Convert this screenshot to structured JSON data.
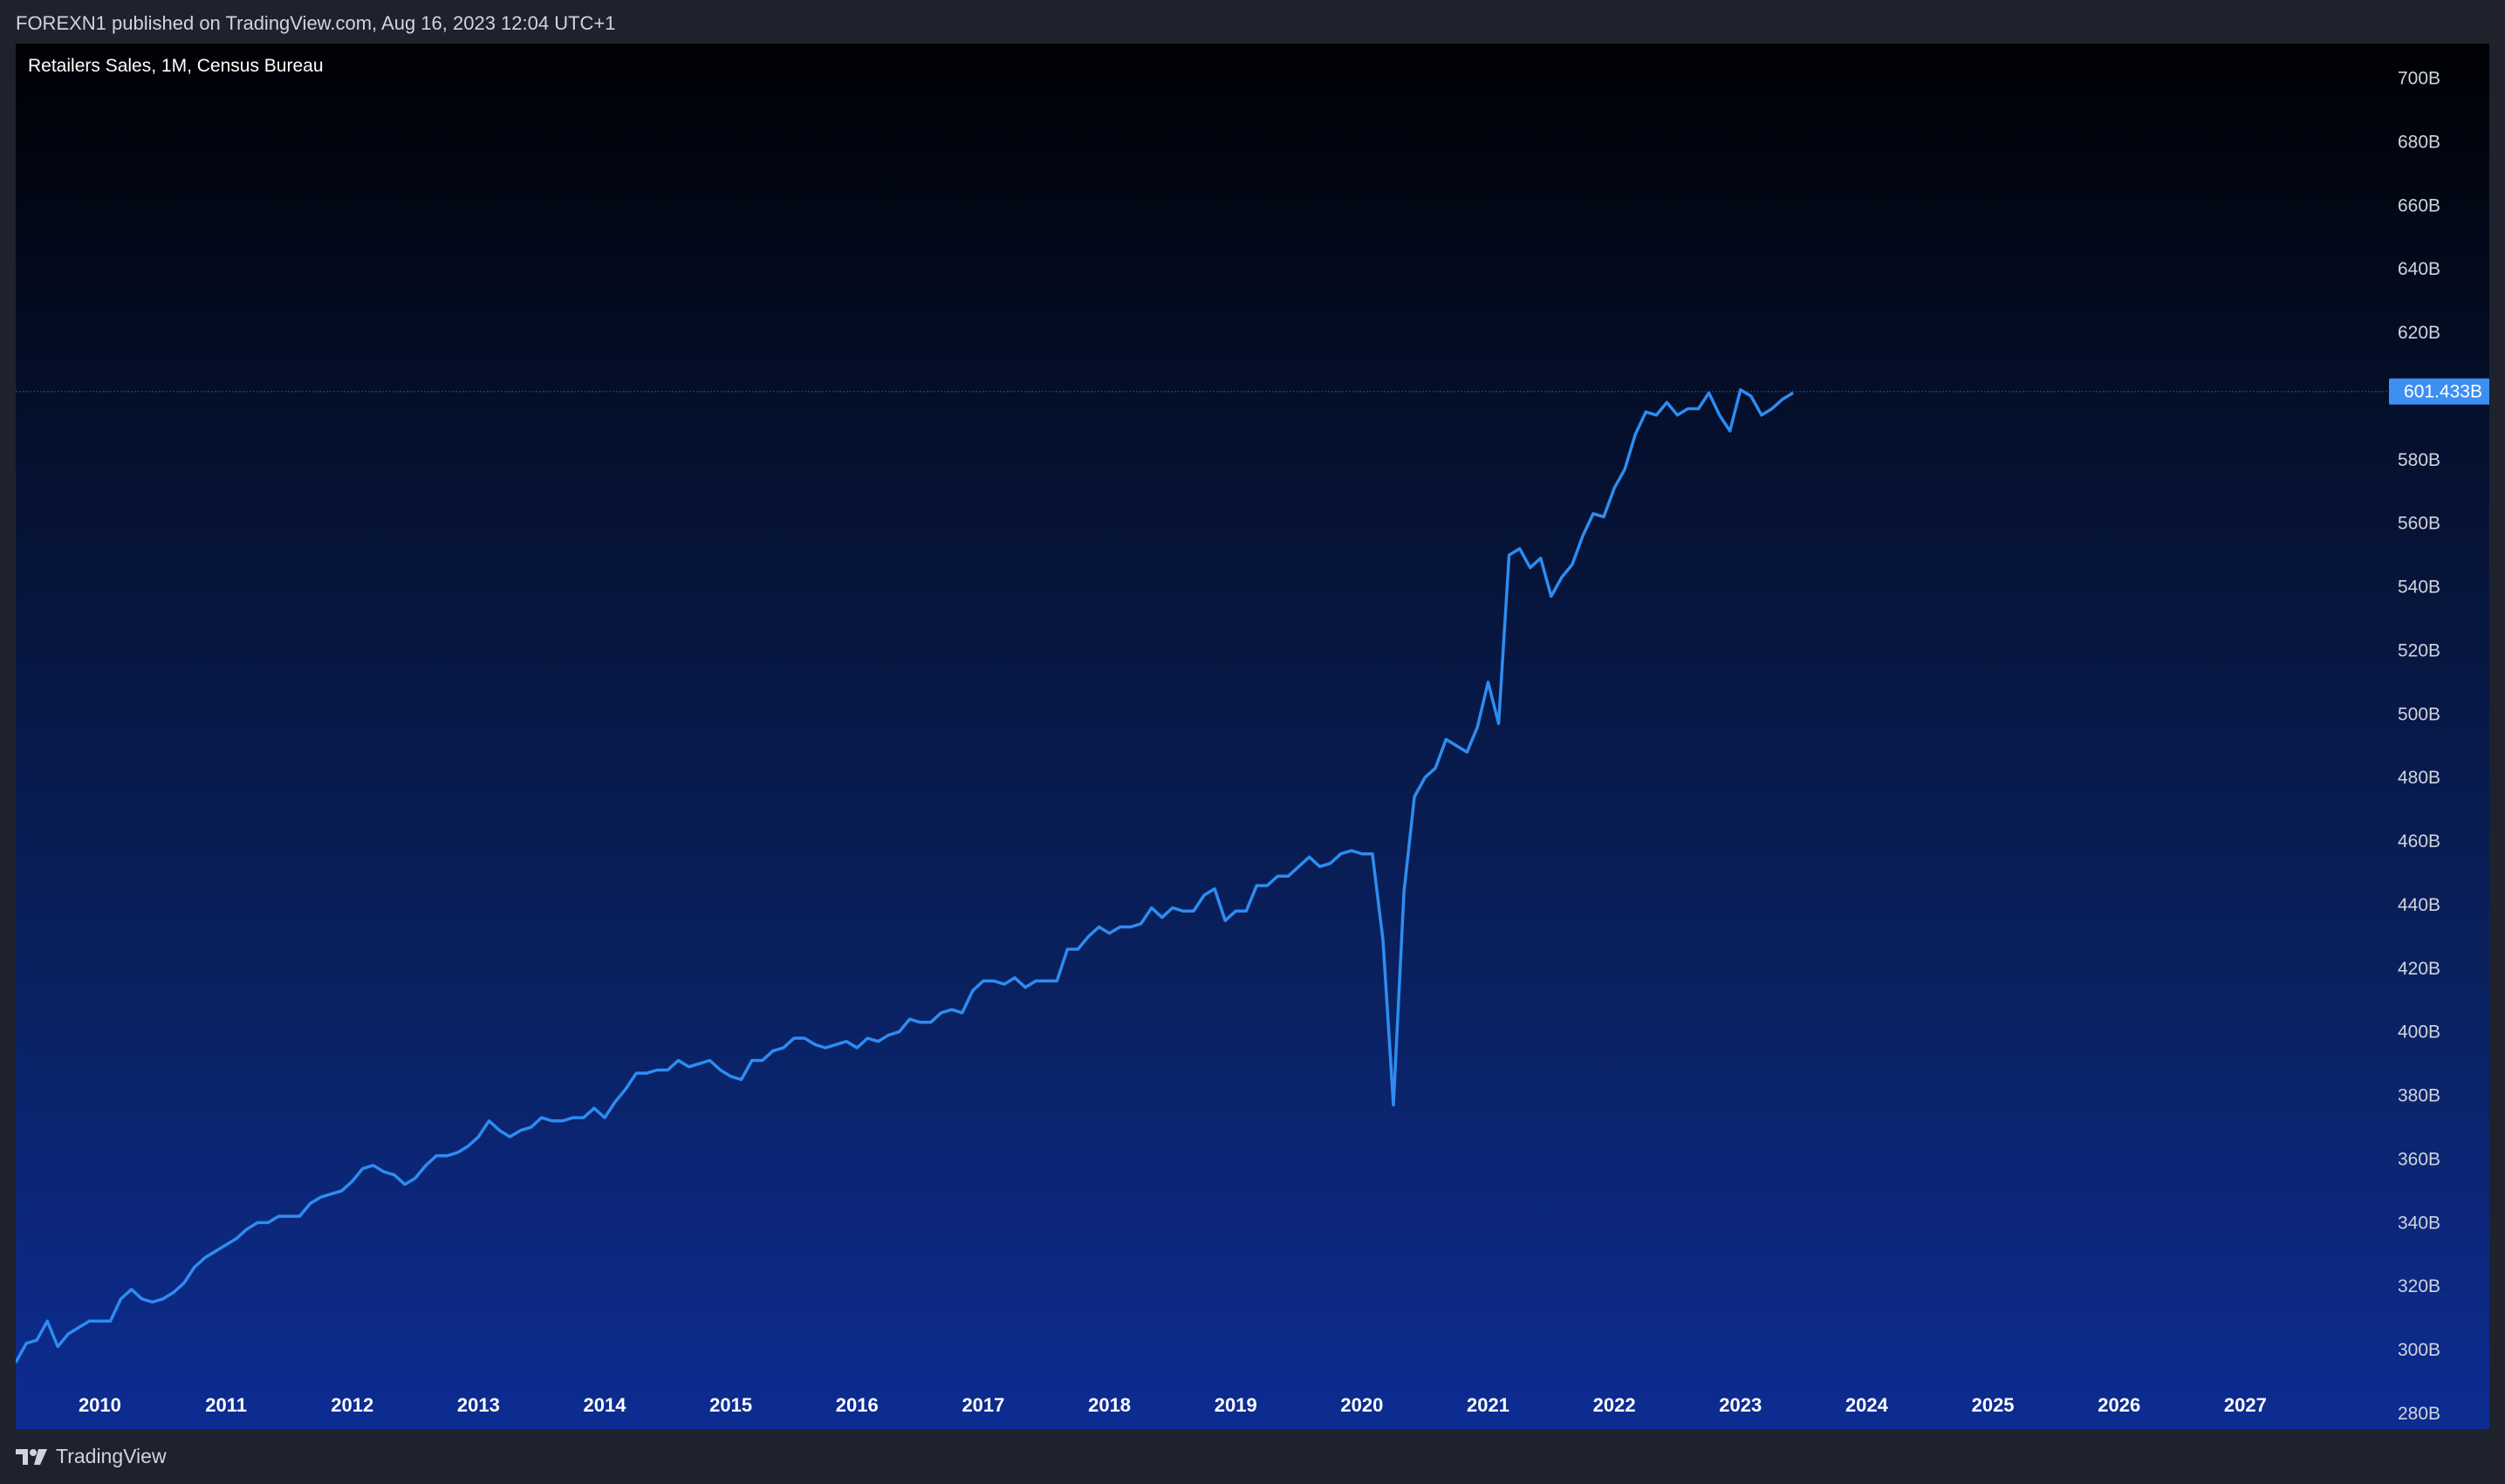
{
  "header": {
    "published": "FOREXN1 published on TradingView.com, Aug 16, 2023 12:04 UTC+1"
  },
  "footer": {
    "brand": "TradingView"
  },
  "colors": {
    "line": "#2e8cf0",
    "price_tag_bg": "#3d8ff2",
    "price_tag_text": "#ffffff"
  },
  "chart_data": {
    "type": "line",
    "title": "Retailers Sales, 1M, Census Bureau",
    "xlabel": "",
    "ylabel": "",
    "x_range": [
      "2009-05",
      "2028-01"
    ],
    "ylim": [
      280,
      704
    ],
    "y_unit": "B",
    "y_ticks": [
      280,
      300,
      320,
      340,
      360,
      380,
      400,
      420,
      440,
      460,
      480,
      500,
      520,
      540,
      560,
      580,
      620,
      640,
      660,
      680,
      700
    ],
    "y_tick_labels": [
      "280B",
      "300B",
      "320B",
      "340B",
      "360B",
      "380B",
      "400B",
      "420B",
      "440B",
      "460B",
      "480B",
      "500B",
      "520B",
      "540B",
      "560B",
      "580B",
      "620B",
      "640B",
      "660B",
      "680B",
      "700B"
    ],
    "x_tick_labels": [
      "2010",
      "2011",
      "2012",
      "2013",
      "2014",
      "2015",
      "2016",
      "2017",
      "2018",
      "2019",
      "2020",
      "2021",
      "2022",
      "2023",
      "2024",
      "2025",
      "2026",
      "2027"
    ],
    "last_value": 601.433,
    "last_value_label": "601.433B",
    "grid": false,
    "series": [
      {
        "x": [
          "2009-05",
          "2009-06",
          "2009-07",
          "2009-08",
          "2009-09",
          "2009-10",
          "2009-11",
          "2009-12",
          "2010-01",
          "2010-02",
          "2010-03",
          "2010-04",
          "2010-05",
          "2010-06",
          "2010-07",
          "2010-08",
          "2010-09",
          "2010-10",
          "2010-11",
          "2010-12",
          "2011-01",
          "2011-02",
          "2011-03",
          "2011-04",
          "2011-05",
          "2011-06",
          "2011-07",
          "2011-08",
          "2011-09",
          "2011-10",
          "2011-11",
          "2011-12",
          "2012-01",
          "2012-02",
          "2012-03",
          "2012-04",
          "2012-05",
          "2012-06",
          "2012-07",
          "2012-08",
          "2012-09",
          "2012-10",
          "2012-11",
          "2012-12",
          "2013-01",
          "2013-02",
          "2013-03",
          "2013-04",
          "2013-05",
          "2013-06",
          "2013-07",
          "2013-08",
          "2013-09",
          "2013-10",
          "2013-11",
          "2013-12",
          "2014-01",
          "2014-02",
          "2014-03",
          "2014-04",
          "2014-05",
          "2014-06",
          "2014-07",
          "2014-08",
          "2014-09",
          "2014-10",
          "2014-11",
          "2014-12",
          "2015-01",
          "2015-02",
          "2015-03",
          "2015-04",
          "2015-05",
          "2015-06",
          "2015-07",
          "2015-08",
          "2015-09",
          "2015-10",
          "2015-11",
          "2015-12",
          "2016-01",
          "2016-02",
          "2016-03",
          "2016-04",
          "2016-05",
          "2016-06",
          "2016-07",
          "2016-08",
          "2016-09",
          "2016-10",
          "2016-11",
          "2016-12",
          "2017-01",
          "2017-02",
          "2017-03",
          "2017-04",
          "2017-05",
          "2017-06",
          "2017-07",
          "2017-08",
          "2017-09",
          "2017-10",
          "2017-11",
          "2017-12",
          "2018-01",
          "2018-02",
          "2018-03",
          "2018-04",
          "2018-05",
          "2018-06",
          "2018-07",
          "2018-08",
          "2018-09",
          "2018-10",
          "2018-11",
          "2018-12",
          "2019-01",
          "2019-02",
          "2019-03",
          "2019-04",
          "2019-05",
          "2019-06",
          "2019-07",
          "2019-08",
          "2019-09",
          "2019-10",
          "2019-11",
          "2019-12",
          "2020-01",
          "2020-02",
          "2020-03",
          "2020-04",
          "2020-05",
          "2020-06",
          "2020-07",
          "2020-08",
          "2020-09",
          "2020-10",
          "2020-11",
          "2020-12",
          "2021-01",
          "2021-02",
          "2021-03",
          "2021-04",
          "2021-05",
          "2021-06",
          "2021-07",
          "2021-08",
          "2021-09",
          "2021-10",
          "2021-11",
          "2021-12",
          "2022-01",
          "2022-02",
          "2022-03",
          "2022-04",
          "2022-05",
          "2022-06",
          "2022-07",
          "2022-08",
          "2022-09",
          "2022-10",
          "2022-11",
          "2022-12",
          "2023-01",
          "2023-02",
          "2023-03",
          "2023-04",
          "2023-05",
          "2023-06"
        ],
        "values": [
          296,
          302,
          303,
          309,
          301,
          305,
          307,
          309,
          309,
          309,
          316,
          319,
          316,
          315,
          316,
          318,
          321,
          326,
          329,
          331,
          333,
          335,
          338,
          340,
          340,
          342,
          342,
          342,
          346,
          348,
          349,
          350,
          353,
          357,
          358,
          356,
          355,
          352,
          354,
          358,
          361,
          361,
          362,
          364,
          367,
          372,
          369,
          367,
          369,
          370,
          373,
          372,
          372,
          373,
          373,
          376,
          373,
          378,
          382,
          387,
          387,
          388,
          388,
          391,
          389,
          390,
          391,
          388,
          386,
          385,
          391,
          391,
          394,
          395,
          398,
          398,
          396,
          395,
          396,
          397,
          395,
          398,
          397,
          399,
          400,
          404,
          403,
          403,
          406,
          407,
          406,
          413,
          416,
          416,
          415,
          417,
          414,
          416,
          416,
          416,
          426,
          426,
          430,
          433,
          431,
          433,
          433,
          434,
          439,
          436,
          439,
          438,
          438,
          443,
          445,
          435,
          438,
          438,
          446,
          446,
          449,
          449,
          452,
          455,
          452,
          453,
          456,
          457,
          456,
          456,
          429,
          377,
          444,
          474,
          480,
          483,
          492,
          490,
          488,
          496,
          510,
          497,
          550,
          552,
          546,
          549,
          537,
          543,
          547,
          556,
          563,
          562,
          571,
          577,
          588,
          595,
          594,
          598,
          594,
          596,
          596,
          601,
          594,
          589,
          602,
          600,
          594,
          596,
          599,
          601
        ]
      }
    ]
  }
}
